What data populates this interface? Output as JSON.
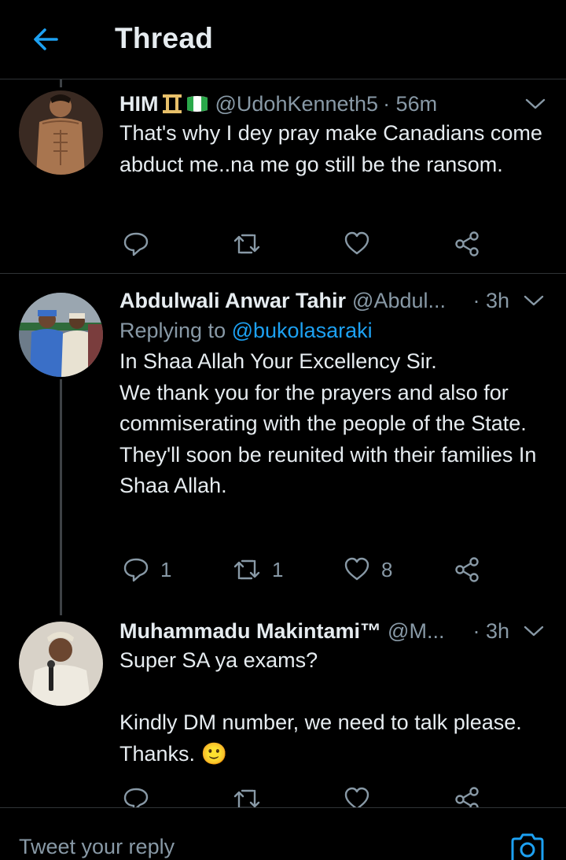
{
  "header": {
    "title": "Thread"
  },
  "tweets": [
    {
      "name": "HIM",
      "name_suffix": "♊🇳🇬",
      "handle": "@UdohKenneth5",
      "time": "· 56m",
      "replying_prefix": "",
      "replying_to": "",
      "text": "That's why I dey pray make Canadians come abduct me..na me go still be the ransom.",
      "replies": "",
      "retweets": "",
      "likes": ""
    },
    {
      "name": "Abdulwali Anwar Tahir",
      "name_suffix": "",
      "handle": "@Abdul...",
      "time": "· 3h",
      "replying_prefix": "Replying to",
      "replying_to": "@bukolasaraki",
      "text": "In Shaa Allah Your Excellency Sir.\nWe thank you for the prayers and also for commiserating with the people of the State.\nThey'll soon be reunited with their families In Shaa Allah.",
      "replies": "1",
      "retweets": "1",
      "likes": "8"
    },
    {
      "name": "Muhammadu Makintami™",
      "name_suffix": "",
      "handle": "@M...",
      "time": "· 3h",
      "replying_prefix": "",
      "replying_to": "",
      "text": "Super SA ya exams?\n\nKindly DM number, we need to talk please. Thanks. 🙂",
      "replies": "",
      "retweets": "",
      "likes": ""
    }
  ],
  "compose": {
    "placeholder": "Tweet your reply"
  },
  "icons": {
    "back": "arrow-left-icon",
    "menu": "chevron-down-icon",
    "reply": "reply-icon",
    "retweet": "retweet-icon",
    "like": "heart-icon",
    "share": "share-icon",
    "camera": "camera-icon"
  },
  "colors": {
    "background": "#000000",
    "accent": "#1da1f2",
    "text": "#e6ecf0",
    "muted": "#8899a6",
    "divider": "#2f3336"
  }
}
